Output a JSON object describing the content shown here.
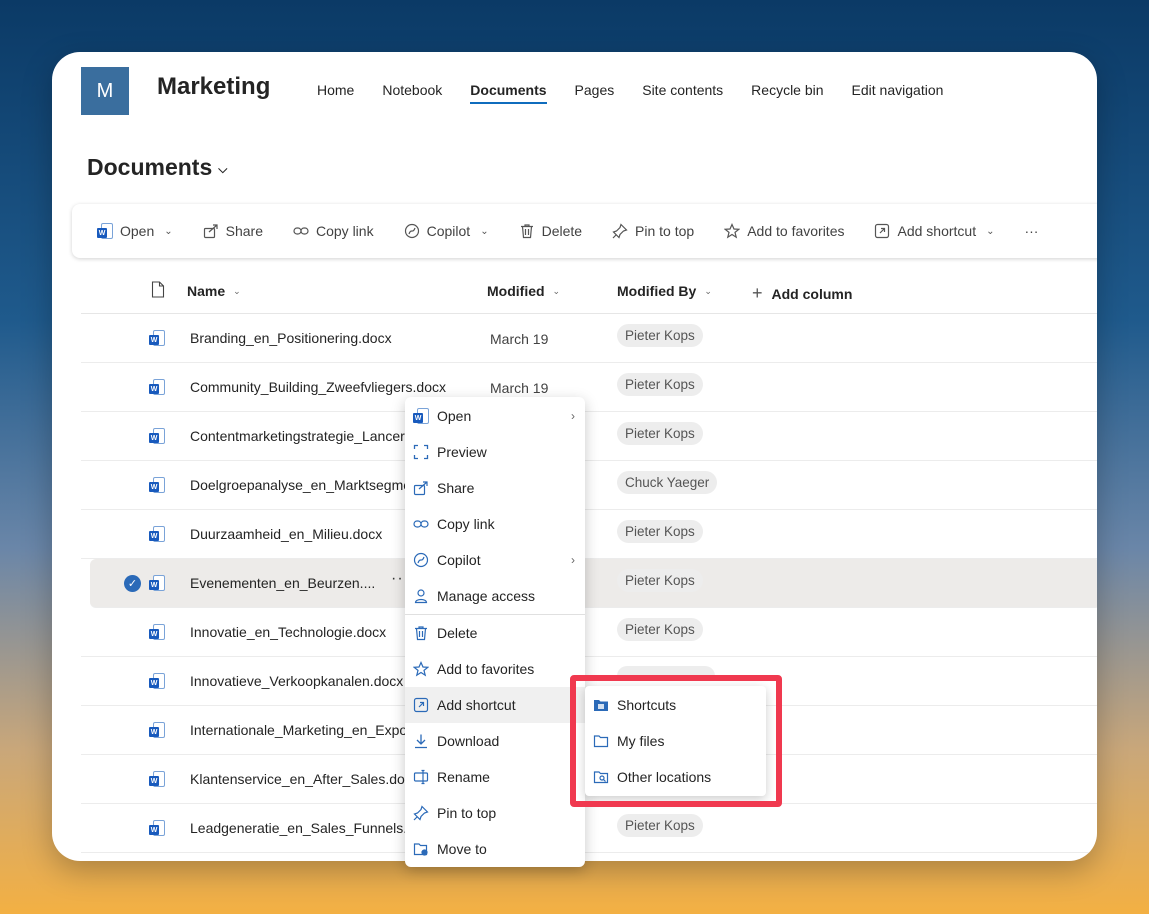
{
  "site": {
    "logo_letter": "M",
    "title": "Marketing"
  },
  "nav": [
    "Home",
    "Notebook",
    "Documents",
    "Pages",
    "Site contents",
    "Recycle bin",
    "Edit navigation"
  ],
  "page_title": "Documents",
  "commands": {
    "open": "Open",
    "share": "Share",
    "copy_link": "Copy link",
    "copilot": "Copilot",
    "delete": "Delete",
    "pin_to_top": "Pin to top",
    "add_to_favorites": "Add to favorites",
    "add_shortcut": "Add shortcut",
    "more": "···"
  },
  "columns": {
    "name": "Name",
    "modified": "Modified",
    "modified_by": "Modified By",
    "add_column": "Add column"
  },
  "files": [
    {
      "name": "Branding_en_Positionering.docx",
      "modified": "March 19",
      "modified_by": "Pieter Kops"
    },
    {
      "name": "Community_Building_Zweefvliegers.docx",
      "modified": "March 19",
      "modified_by": "Pieter Kops"
    },
    {
      "name": "Contentmarketingstrategie_Lanceri",
      "modified": "",
      "modified_by": "Pieter Kops"
    },
    {
      "name": "Doelgroepanalyse_en_Marktsegme",
      "modified": "",
      "modified_by": "Chuck Yaeger"
    },
    {
      "name": "Duurzaamheid_en_Milieu.docx",
      "modified": "",
      "modified_by": "Pieter Kops"
    },
    {
      "name": "Evenementen_en_Beurzen....",
      "modified": "",
      "modified_by": "Pieter Kops",
      "selected": true
    },
    {
      "name": "Innovatie_en_Technologie.docx",
      "modified": "",
      "modified_by": "Pieter Kops"
    },
    {
      "name": "Innovatieve_Verkoopkanalen.docx",
      "modified": "",
      "modified_by": ""
    },
    {
      "name": "Internationale_Marketing_en_Expor",
      "modified": "",
      "modified_by": ""
    },
    {
      "name": "Klantenservice_en_After_Sales.docx",
      "modified": "",
      "modified_by": ""
    },
    {
      "name": "Leadgeneratie_en_Sales_Funnels.do",
      "modified": "",
      "modified_by": "Pieter Kops"
    }
  ],
  "context_menu": {
    "open": "Open",
    "preview": "Preview",
    "share": "Share",
    "copy_link": "Copy link",
    "copilot": "Copilot",
    "manage_access": "Manage access",
    "delete": "Delete",
    "add_to_favorites": "Add to favorites",
    "add_shortcut": "Add shortcut",
    "download": "Download",
    "rename": "Rename",
    "pin_to_top": "Pin to top",
    "move_to": "Move to"
  },
  "submenu": {
    "shortcuts": "Shortcuts",
    "my_files": "My files",
    "other_locations": "Other locations"
  },
  "colors": {
    "accent": "#0f6cbd",
    "highlight_border": "#f0394f",
    "site_logo": "#3a6e9e"
  }
}
